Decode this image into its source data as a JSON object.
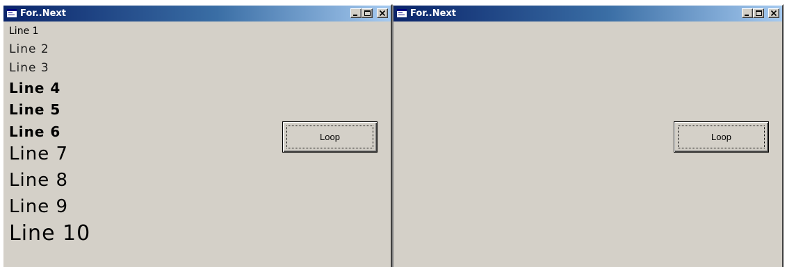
{
  "windows": [
    {
      "title": "For..Next",
      "lines": [
        "Line 1",
        "Line 2",
        "Line 3",
        "Line 4",
        "Line 5",
        "Line 6",
        "Line 7",
        "Line 8",
        "Line 9",
        "Line 10"
      ],
      "button_label": "Loop"
    },
    {
      "title": "For..Next",
      "lines": [],
      "button_label": "Loop"
    }
  ],
  "icons": {
    "app": "form-window-icon",
    "minimize": "minimize-icon",
    "maximize": "maximize-icon",
    "close": "close-icon"
  },
  "colors": {
    "titlebar_start": "#0a246a",
    "titlebar_end": "#a6caf0",
    "face": "#d4d0c8"
  }
}
